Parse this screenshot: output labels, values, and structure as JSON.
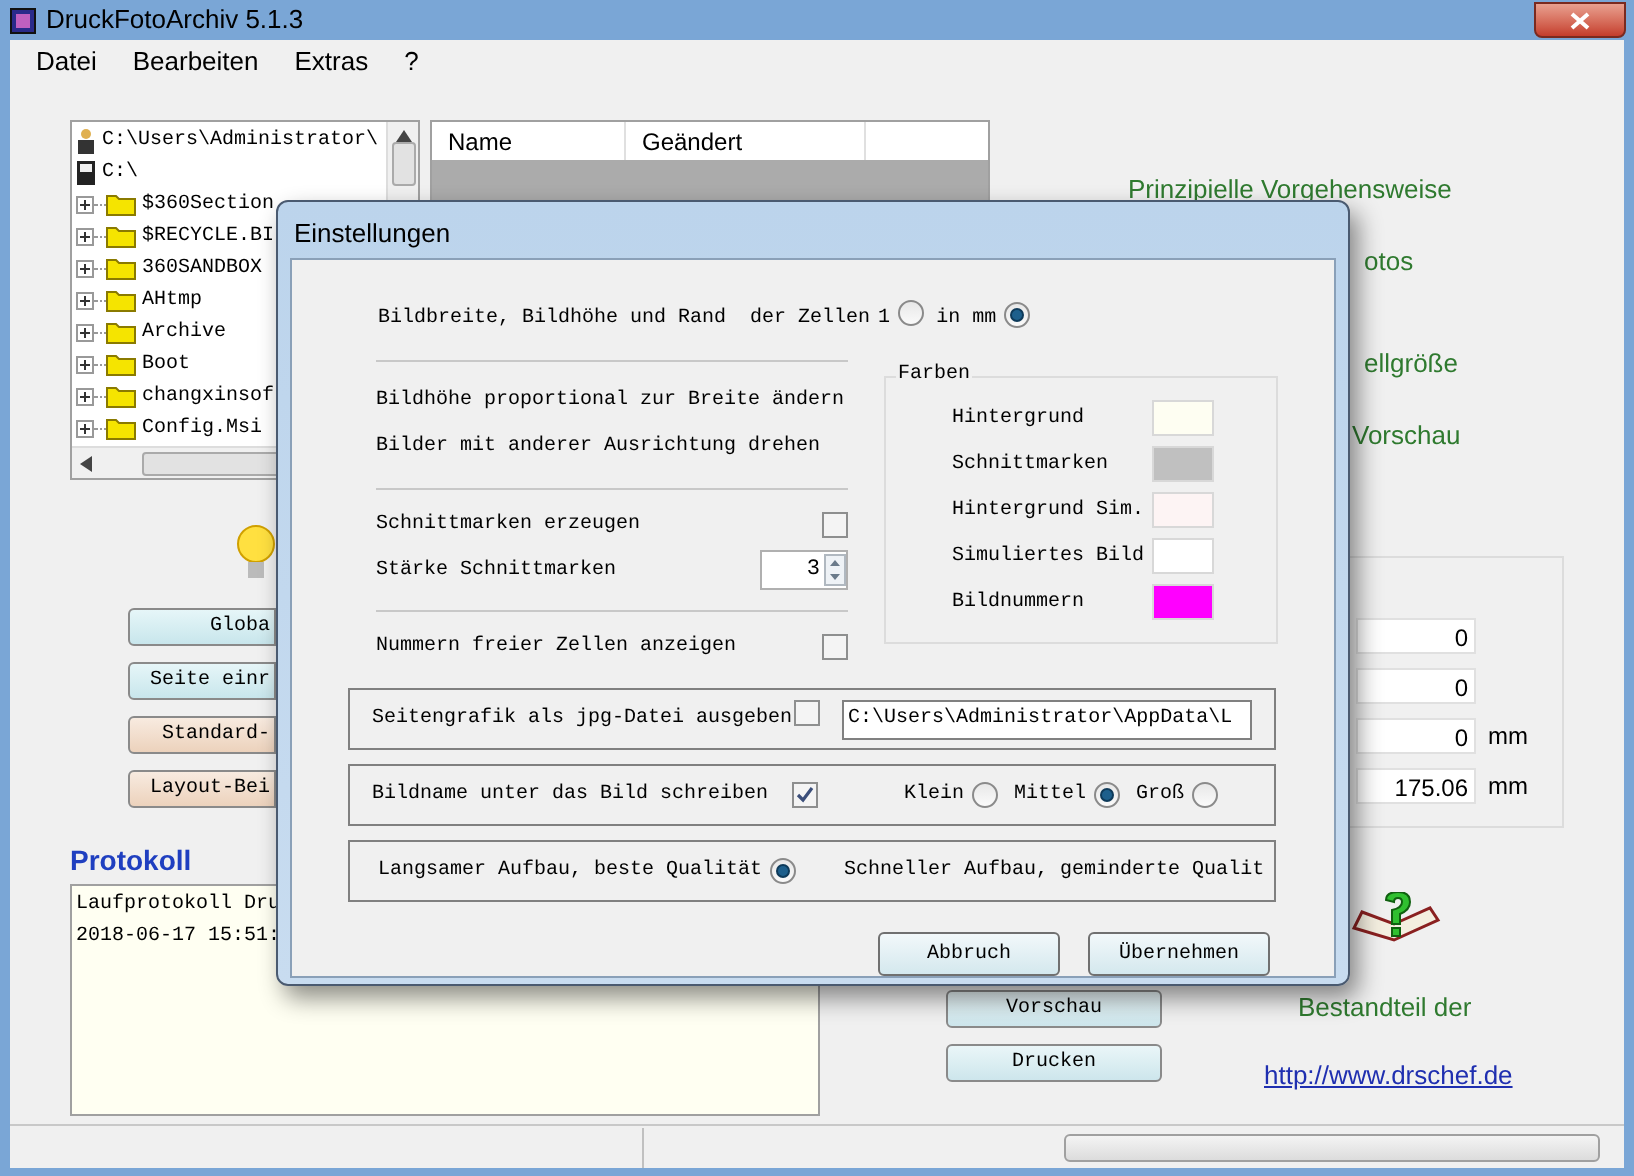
{
  "window": {
    "title": "DruckFotoArchiv  5.1.3"
  },
  "menu": [
    "Datei",
    "Bearbeiten",
    "Extras",
    "?"
  ],
  "tree": [
    {
      "label": "C:\\Users\\Administrator\\",
      "kind": "user"
    },
    {
      "label": "C:\\",
      "kind": "drive"
    },
    {
      "label": "$360Section",
      "kind": "folder"
    },
    {
      "label": "$RECYCLE.BI",
      "kind": "folder"
    },
    {
      "label": "360SANDBOX",
      "kind": "folder"
    },
    {
      "label": "AHtmp",
      "kind": "folder"
    },
    {
      "label": "Archive",
      "kind": "folder"
    },
    {
      "label": "Boot",
      "kind": "folder"
    },
    {
      "label": "changxinsof",
      "kind": "folder"
    },
    {
      "label": "Config.Msi",
      "kind": "folder"
    }
  ],
  "file_list": {
    "columns": [
      "Name",
      "Geändert"
    ]
  },
  "guide_texts": [
    "Prinzipielle Vorgehensweise",
    "otos",
    "ellgröße",
    "Vorschau"
  ],
  "side_buttons": [
    {
      "label": "Globa",
      "kind": "cyan"
    },
    {
      "label": "Seite einr",
      "kind": "cyan"
    },
    {
      "label": "Standard-",
      "kind": "peach"
    },
    {
      "label": "Layout-Bei",
      "kind": "peach"
    }
  ],
  "protokoll": {
    "title": "Protokoll",
    "lines": [
      "Laufprotokoll Dru",
      "2018-06-17 15:51:"
    ]
  },
  "values_group": {
    "fields": [
      {
        "value": "0"
      },
      {
        "value": "0"
      },
      {
        "value": "0",
        "unit": "mm"
      },
      {
        "value": "175.06",
        "unit": "mm"
      }
    ]
  },
  "action_buttons": [
    "Vorschau",
    "Drucken"
  ],
  "progress": {
    "level": 0
  },
  "about": {
    "text": "Bestandteil der",
    "link": "http://www.drschef.de"
  },
  "dialog": {
    "title": "Einstellungen",
    "size_row": {
      "label": "Bildbreite, Bildhöhe und Rand  der Zellen",
      "options": [
        {
          "label": "1",
          "selected": false
        },
        {
          "label": "in mm",
          "selected": true
        }
      ]
    },
    "texts": [
      "Bildhöhe proportional zur Breite ändern",
      "Bilder mit anderer Ausrichtung drehen"
    ],
    "cut_marks": {
      "label": "Schnittmarken erzeugen",
      "checked": false
    },
    "cut_strength": {
      "label": "Stärke Schnittmarken",
      "value": "3"
    },
    "free_numbers": {
      "label": "Nummern freier Zellen anzeigen",
      "checked": false
    },
    "colors": {
      "title": "Farben",
      "items": [
        {
          "label": "Hintergrund",
          "color": "#fefef2"
        },
        {
          "label": "Schnittmarken",
          "color": "#c0c0c0"
        },
        {
          "label": "Hintergrund Sim.",
          "color": "#fdf4f4"
        },
        {
          "label": "Simuliertes Bild",
          "color": "#ffffff"
        },
        {
          "label": "Bildnummern",
          "color": "#ff00ff"
        }
      ]
    },
    "jpg_export": {
      "label": "Seitengrafik als jpg-Datei ausgeben",
      "checked": false,
      "path": "C:\\Users\\Administrator\\AppData\\L"
    },
    "image_name": {
      "label": "Bildname unter das Bild schreiben",
      "checked": true,
      "sizes": [
        {
          "label": "Klein",
          "selected": false
        },
        {
          "label": "Mittel",
          "selected": true
        },
        {
          "label": "Groß",
          "selected": false
        }
      ]
    },
    "quality": {
      "option": {
        "label": "Langsamer Aufbau, beste Qualität",
        "selected": true
      },
      "note": "Schneller Aufbau, geminderte Qualit"
    },
    "buttons": [
      "Abbruch",
      "Übernehmen"
    ]
  }
}
